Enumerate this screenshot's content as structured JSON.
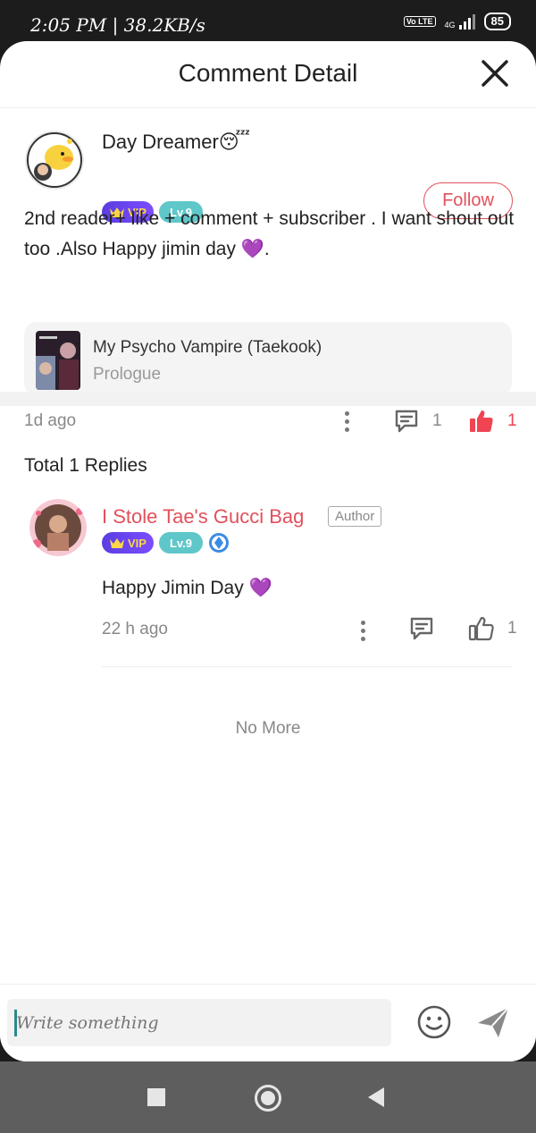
{
  "status_bar": {
    "time": "2:05 PM | 38.2KB/s",
    "network": "4G",
    "volte": "Vo LTE",
    "battery": "85"
  },
  "header": {
    "title": "Comment Detail"
  },
  "comment": {
    "user_name": "Day Dreamer😴",
    "vip_label": "VIP",
    "level_label": "Lv.9",
    "follow_label": "Follow",
    "text": "2nd reader+ like + comment + subscriber . I want shout out too .Also Happy jimin day 💜.",
    "book": {
      "title": "My Psycho Vampire (Taekook)",
      "chapter": "Prologue"
    },
    "time": "1d ago",
    "reply_count": "1",
    "like_count": "1"
  },
  "replies": {
    "title": "Total 1 Replies",
    "items": [
      {
        "user_name": "I Stole Tae's Gucci Bag",
        "author_tag": "Author",
        "vip_label": "VIP",
        "level_label": "Lv.9",
        "text": "Happy Jimin Day 💜",
        "time": "22 h ago",
        "like_count": "1"
      }
    ],
    "end_text": "No More"
  },
  "input": {
    "placeholder": "Write something"
  },
  "colors": {
    "accent": "#e2505c",
    "like_active": "#ef4452",
    "level_badge": "#5fc7c9",
    "vip_badge": "#6a45ee"
  }
}
